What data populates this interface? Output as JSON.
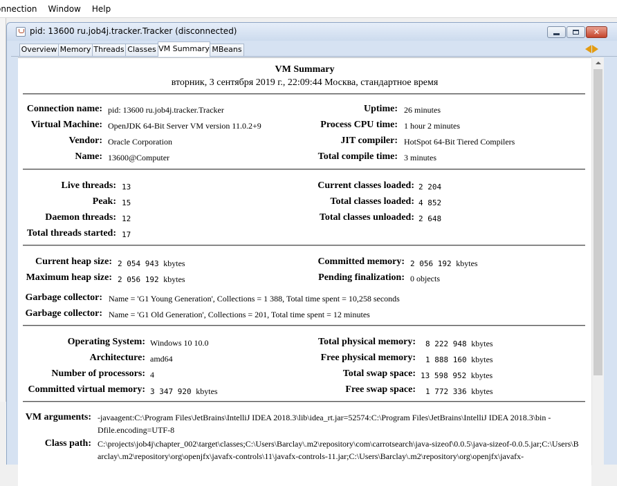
{
  "menubar": {
    "items": [
      "onnection",
      "Window",
      "Help"
    ]
  },
  "window": {
    "title": "pid: 13600 ru.job4j.tracker.Tracker (disconnected)",
    "buttons": {
      "minimize": "minimize",
      "maximize": "maximize",
      "close": "close"
    }
  },
  "tabs": [
    {
      "label": "Overview"
    },
    {
      "label": "Memory"
    },
    {
      "label": "Threads"
    },
    {
      "label": "Classes"
    },
    {
      "label": "VM Summary",
      "active": true
    },
    {
      "label": "MBeans"
    }
  ],
  "summary": {
    "title": "VM Summary",
    "datetime": "вторник, 3 сентября 2019 г., 22:09:44 Москва, стандартное время"
  },
  "vm_info": {
    "connection_name": {
      "label": "Connection name:",
      "value": "pid: 13600 ru.job4j.tracker.Tracker"
    },
    "virtual_machine": {
      "label": "Virtual Machine:",
      "value": "OpenJDK 64-Bit Server VM version 11.0.2+9"
    },
    "vendor": {
      "label": "Vendor:",
      "value": "Oracle Corporation"
    },
    "name": {
      "label": "Name:",
      "value": "13600@Computer"
    },
    "uptime": {
      "label": "Uptime:",
      "value": "26 minutes"
    },
    "process_cpu_time": {
      "label": "Process CPU time:",
      "value": "1 hour 2 minutes"
    },
    "jit_compiler": {
      "label": "JIT compiler:",
      "value": "HotSpot 64-Bit Tiered Compilers"
    },
    "total_compile_time": {
      "label": "Total compile time:",
      "value": "3 minutes"
    }
  },
  "threads": {
    "live_threads": {
      "label": "Live threads:",
      "value": "13"
    },
    "peak": {
      "label": "Peak:",
      "value": "15"
    },
    "daemon_threads": {
      "label": "Daemon threads:",
      "value": "12"
    },
    "total_threads_started": {
      "label": "Total threads started:",
      "value": "17"
    },
    "current_classes_loaded": {
      "label": "Current classes loaded:",
      "value": "2 204"
    },
    "total_classes_loaded": {
      "label": "Total classes loaded:",
      "value": "4 852"
    },
    "total_classes_unloaded": {
      "label": "Total classes unloaded:",
      "value": "2 648"
    }
  },
  "memory": {
    "current_heap_size": {
      "label": "Current heap size:",
      "value": "2 054 943",
      "unit": "kbytes"
    },
    "maximum_heap_size": {
      "label": "Maximum heap size:",
      "value": "2 056 192",
      "unit": "kbytes"
    },
    "committed_memory": {
      "label": "Committed memory:",
      "value": "2 056 192",
      "unit": "kbytes"
    },
    "pending_finalization": {
      "label": "Pending finalization:",
      "value": "0 objects"
    },
    "gc_1": {
      "label": "Garbage collector:",
      "value": "Name = 'G1 Young Generation', Collections = 1 388, Total time spent = 10,258 seconds"
    },
    "gc_2": {
      "label": "Garbage collector:",
      "value": "Name = 'G1 Old Generation', Collections = 201, Total time spent = 12 minutes"
    }
  },
  "os": {
    "operating_system": {
      "label": "Operating System:",
      "value": "Windows 10 10.0"
    },
    "architecture": {
      "label": "Architecture:",
      "value": "amd64"
    },
    "number_of_processors": {
      "label": "Number of processors:",
      "value": "4"
    },
    "committed_virtual_memory": {
      "label": "Committed virtual memory:",
      "value": "3 347 920",
      "unit": "kbytes"
    },
    "total_physical_memory": {
      "label": "Total physical memory:",
      "value": "8 222 948",
      "unit": "kbytes"
    },
    "free_physical_memory": {
      "label": "Free physical memory:",
      "value": "1 888 160",
      "unit": "kbytes"
    },
    "total_swap_space": {
      "label": "Total swap space:",
      "value": "13 598 952",
      "unit": "kbytes"
    },
    "free_swap_space": {
      "label": "Free swap space:",
      "value": "1 772 336",
      "unit": "kbytes"
    }
  },
  "args": {
    "vm_arguments": {
      "label": "VM arguments:",
      "value": "-javaagent:C:\\Program Files\\JetBrains\\IntelliJ IDEA 2018.3\\lib\\idea_rt.jar=52574:C:\\Program Files\\JetBrains\\IntelliJ IDEA 2018.3\\bin -Dfile.encoding=UTF-8"
    },
    "class_path": {
      "label": "Class path:",
      "value": "C:\\projects\\job4j\\chapter_002\\target\\classes;C:\\Users\\Barclay\\.m2\\repository\\com\\carrotsearch\\java-sizeof\\0.0.5\\java-sizeof-0.0.5.jar;C:\\Users\\Barclay\\.m2\\repository\\org\\openjfx\\javafx-controls\\11\\javafx-controls-11.jar;C:\\Users\\Barclay\\.m2\\repository\\org\\openjfx\\javafx-"
    }
  }
}
